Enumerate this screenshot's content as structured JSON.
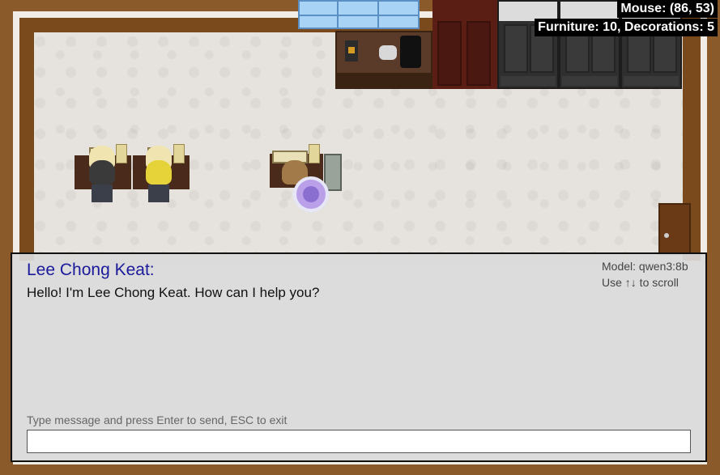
{
  "hud": {
    "mouse": "Mouse: (86, 53)",
    "counts": "Furniture: 10, Decorations: 5"
  },
  "dialog": {
    "speaker": "Lee Chong Keat:",
    "message": "Hello! I'm Lee Chong Keat. How can I help you?",
    "model": "Model: qwen3:8b",
    "scroll_hint": "Use ↑↓ to scroll",
    "instructions": "Type message and press Enter to send, ESC to exit",
    "input_value": ""
  },
  "colors": {
    "speaker_name": "#1a1a9a",
    "wall_frame": "#7a4a1c",
    "floor": "#e6e3de",
    "player": "#b9a0e8"
  },
  "icons": {
    "player": "player-orb-icon",
    "npc": "npc-character-icon"
  }
}
